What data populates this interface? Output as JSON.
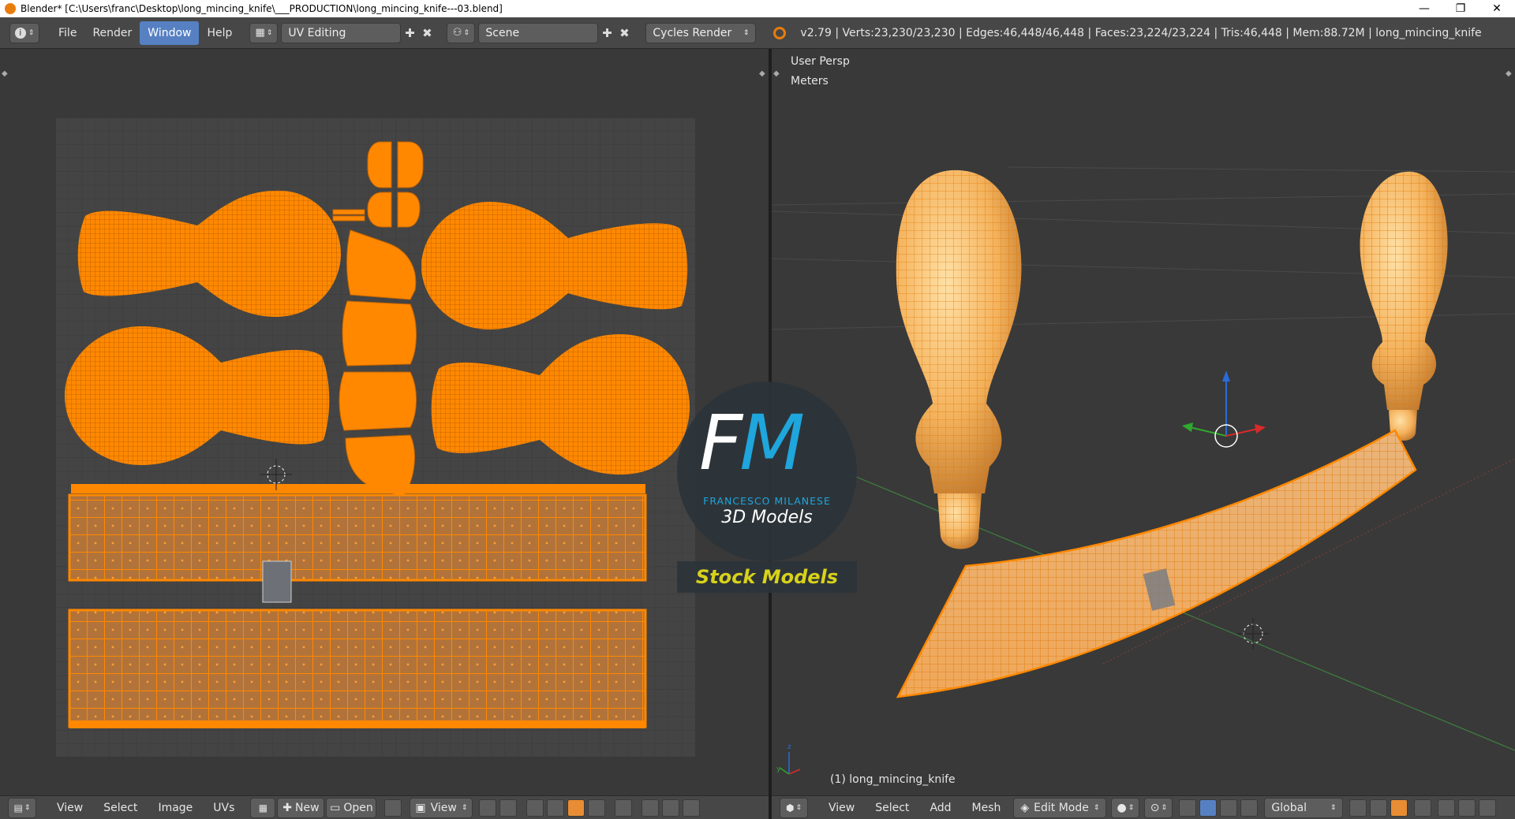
{
  "window": {
    "title": "Blender* [C:\\Users\\franc\\Desktop\\long_mincing_knife\\___PRODUCTION\\long_mincing_knife---03.blend]",
    "minimize": "—",
    "maximize": "❐",
    "close": "✕"
  },
  "info_header": {
    "menus": [
      "File",
      "Render",
      "Window",
      "Help"
    ],
    "active_menu": "Window",
    "screen_layout": "UV Editing",
    "scene": "Scene",
    "render_engine": "Cycles Render",
    "stats": "v2.79 | Verts:23,230/23,230 | Edges:46,448/46,448 | Faces:23,224/23,224 | Tris:46,448 | Mem:88.72M | long_mincing_knife"
  },
  "viewport": {
    "view_name": "User Persp",
    "units": "Meters",
    "object_label": "(1) long_mincing_knife"
  },
  "watermark": {
    "logo_letters_f": "F",
    "logo_letters_m": "M",
    "brand_name": "FRANCESCO MILANESE",
    "subtitle": "3D Models",
    "tagline": "Stock Models"
  },
  "uv_bottom_bar": {
    "menus": [
      "View",
      "Select",
      "Image",
      "UVs"
    ],
    "new_label": "New",
    "open_label": "Open",
    "view_label": "View"
  },
  "view3d_bottom_bar": {
    "menus": [
      "View",
      "Select",
      "Add",
      "Mesh"
    ],
    "mode": "Edit Mode",
    "orientation": "Global"
  },
  "colors": {
    "accent_orange": "#ff8800",
    "selection_blue": "#5680c2",
    "brand_blue": "#1ea6dd",
    "tagline_yellow": "#d8d21a"
  }
}
